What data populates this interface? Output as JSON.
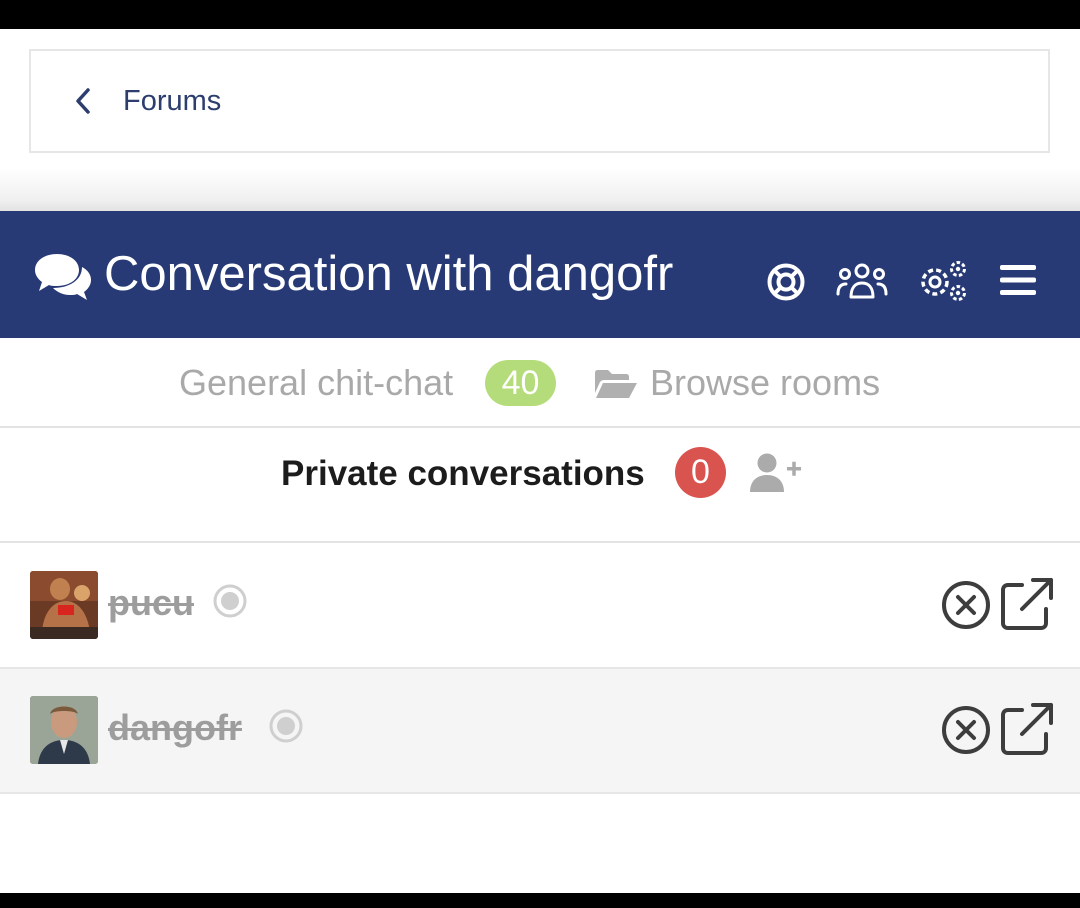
{
  "breadcrumb": {
    "back_label": "Forums",
    "icon": "chevron-left-icon"
  },
  "header": {
    "title": "Conversation with dangofr",
    "background_color": "#273a75",
    "icons": [
      "chat-bubbles-icon",
      "lifebuoy-icon",
      "users-icon",
      "gears-icon",
      "hamburger-menu-icon"
    ]
  },
  "rooms": {
    "current_room": "General chit-chat",
    "current_room_count": "40",
    "browse_label": "Browse rooms"
  },
  "private": {
    "title": "Private conversations",
    "count": "0",
    "add_icon": "add-user-icon"
  },
  "conversations": [
    {
      "username": "pucu",
      "status": "offline"
    },
    {
      "username": "dangofr",
      "status": "offline"
    }
  ],
  "colors": {
    "header": "#273a75",
    "green_badge": "#b5dc7a",
    "red_badge": "#d9534f",
    "muted_text": "#a9a9a9"
  }
}
